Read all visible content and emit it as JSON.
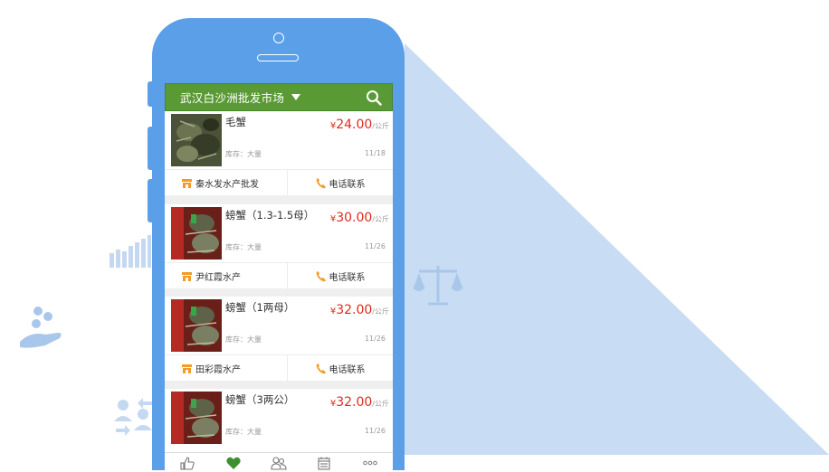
{
  "header": {
    "market_name": "武汉白沙洲批发市场",
    "dropdown_icon": "caret-down-icon",
    "search_icon": "search-icon"
  },
  "products": [
    {
      "name": "毛蟹",
      "currency": "¥",
      "price": "24.00",
      "unit": "/公斤",
      "stock": "库存：大量",
      "date": "11/18",
      "shop": "秦水发水产批发",
      "contact": "电话联系",
      "photo": "crab-photo"
    },
    {
      "name": "螃蟹（1.3-1.5母）",
      "currency": "¥",
      "price": "30.00",
      "unit": "/公斤",
      "stock": "库存：大量",
      "date": "11/26",
      "shop": "尹红霞水产",
      "contact": "电话联系",
      "photo": "crab-photo"
    },
    {
      "name": "螃蟹（1两母）",
      "currency": "¥",
      "price": "32.00",
      "unit": "/公斤",
      "stock": "库存：大量",
      "date": "11/26",
      "shop": "田彩霞水产",
      "contact": "电话联系",
      "photo": "crab-photo"
    },
    {
      "name": "螃蟹（3两公）",
      "currency": "¥",
      "price": "32.00",
      "unit": "/公斤",
      "stock": "库存：大量",
      "date": "11/26",
      "shop": "",
      "contact": "",
      "photo": "crab-photo"
    }
  ],
  "bottom_tabs": [
    {
      "icon": "thumbs-up-icon",
      "active": false
    },
    {
      "icon": "heart-icon",
      "active": true
    },
    {
      "icon": "users-icon",
      "active": false
    },
    {
      "icon": "calendar-icon",
      "active": false
    },
    {
      "icon": "more-icon",
      "active": false
    }
  ],
  "colors": {
    "header_green": "#5a9a35",
    "price_red": "#e02a1e",
    "phone_blue": "#5b9fe9",
    "beam_blue": "#c8dcf3",
    "shop_icon_orange": "#f59b23"
  },
  "background_icons": [
    "bar-chart-icon",
    "scales-icon",
    "coins-hand-icon",
    "people-exchange-icon"
  ]
}
